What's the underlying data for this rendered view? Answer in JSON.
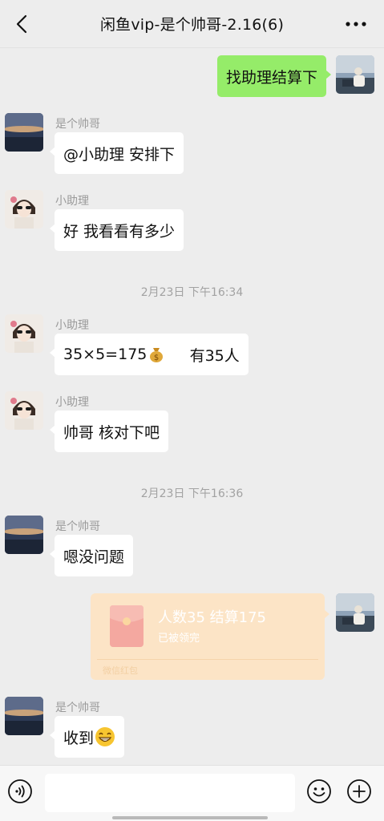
{
  "header": {
    "title": "闲鱼vip-是个帅哥-2.16(6)",
    "back_icon": "chevron-left-icon",
    "more_icon": "ellipsis-icon"
  },
  "colors": {
    "background": "#ededed",
    "outgoing_bubble": "#95ec69",
    "incoming_bubble": "#ffffff",
    "red_packet_bg": "#fce4c6"
  },
  "messages": [
    {
      "direction": "out",
      "text": "找助理结算下"
    },
    {
      "direction": "in",
      "sender": "是个帅哥",
      "text": "@小助理  安排下"
    },
    {
      "direction": "in",
      "sender": "小助理",
      "text": "好 我看看有多少"
    },
    {
      "direction": "in",
      "sender": "小助理",
      "text": "35×5=175",
      "text_suffix": "     有35人",
      "emoji": "money-bag-icon"
    },
    {
      "direction": "in",
      "sender": "小助理",
      "text": "帅哥 核对下吧"
    },
    {
      "direction": "in",
      "sender": "是个帅哥",
      "text": "嗯没问题"
    },
    {
      "direction": "in",
      "sender": "是个帅哥",
      "text": "收到",
      "emoji": "grinning-face-icon"
    }
  ],
  "timestamps": [
    "2月23日 下午16:34",
    "2月23日 下午16:36"
  ],
  "red_packet": {
    "title": "人数35  结算175",
    "status": "已被领完",
    "footer": "微信红包"
  },
  "input_bar": {
    "voice_icon": "voice-icon",
    "emoji_icon": "emoji-icon",
    "plus_icon": "plus-icon",
    "placeholder": ""
  }
}
